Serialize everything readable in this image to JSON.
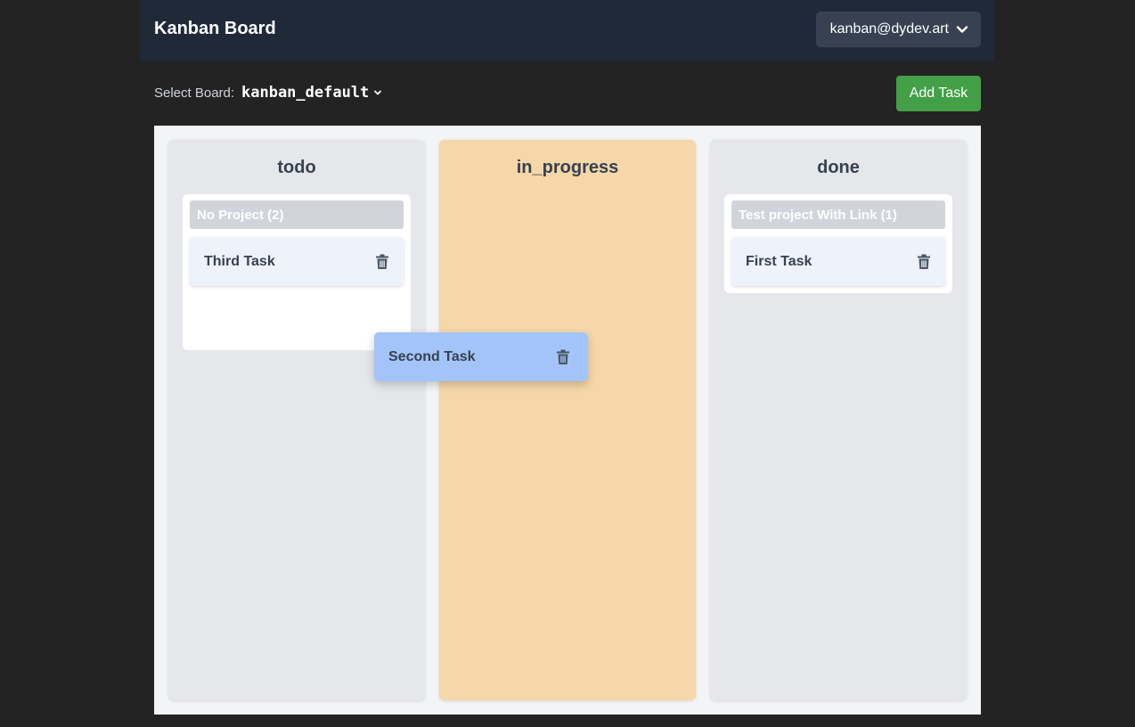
{
  "header": {
    "title": "Kanban Board",
    "user_email": "kanban@dydev.art",
    "user_menu_icon": "chevron-down-icon"
  },
  "toolbar": {
    "select_board_label": "Select Board:",
    "selected_board": "kanban_default",
    "add_task_label": "Add Task"
  },
  "columns": [
    {
      "title": "todo",
      "groups": [
        {
          "header": "No Project (2)",
          "tasks": [
            {
              "title": "Third Task"
            }
          ]
        }
      ]
    },
    {
      "title": "in_progress",
      "groups": []
    },
    {
      "title": "done",
      "groups": [
        {
          "header": "Test project With Link (1)",
          "tasks": [
            {
              "title": "First Task"
            }
          ]
        }
      ]
    }
  ],
  "dragging_task": {
    "title": "Second Task"
  },
  "colors": {
    "header_bg": "#1f2937",
    "add_button": "#43a047",
    "drop_target_column": "#f5d7a9",
    "dragging_card": "#a3c4f8"
  }
}
